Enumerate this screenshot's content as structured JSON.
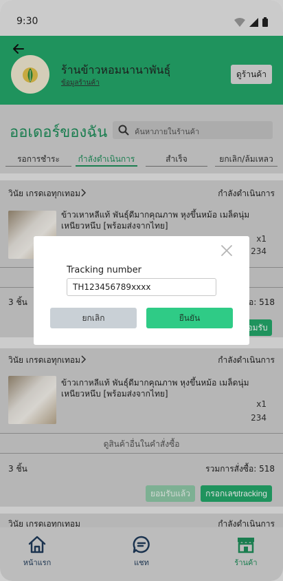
{
  "status_bar": {
    "time": "9:30"
  },
  "header": {
    "shop_name": "ร้านข้าวหอมนานาพันธุ์",
    "shop_info_link": "ข้อมูลร้านค้า",
    "view_shop_button": "ดูร้านค้า"
  },
  "page": {
    "title": "ออเดอร์ของฉัน",
    "search_placeholder": "ค้นหาภายในร้านค้า"
  },
  "tabs": [
    {
      "label": "รอการชำระ"
    },
    {
      "label": "กำลังดำเนินการ"
    },
    {
      "label": "สำเร็จ"
    },
    {
      "label": "ยกเลิก/ล้มเหลว"
    }
  ],
  "orders": [
    {
      "seller": "วินัย เกรดเอทุกเทอม",
      "status": "กำลังดำเนินการ",
      "product_name": "ข้าวเหาหลีแท้ พันธุ์ดีมากคุณภาพ หุงขึ้นหม้อ  เมล็ดนุ่มเหนียวหนึบ [พร้อมส่งจากไทย]",
      "quantity": "x1",
      "price": "234",
      "count": "3 ชิ้น",
      "total_label": "รวมการสั่งซื้อ:",
      "total_partial": "ซื้อ:",
      "total_value": "518",
      "action_partial": "อมรับ"
    },
    {
      "seller": "วินัย เกรดเอทุกเทอม",
      "status": "กำลังดำเนินการ",
      "product_name": "ข้าวเกาหลีแท้ พันธุ์ดีมากคุณภาพ หุงขึ้นหม้อ  เมล็ดนุ่มเหนียวหนึบ [พร้อมส่งจากไทย]",
      "quantity": "x1",
      "price": "234",
      "see_more": "ดูสินค้าอื่นในคำสั่งซื้อ",
      "count": "3 ชิ้น",
      "total_label": "รวมการสั่งซื้อ:",
      "total_value": "518",
      "received_button": "ยอมรับแล้ว",
      "tracking_button": "กรอกเลขtracking"
    },
    {
      "seller": "วินัย เกรดเอทุกเทอม",
      "status": "กำลังดำเนินการ"
    }
  ],
  "modal": {
    "label": "Tracking number",
    "input_value": "TH123456789xxxx",
    "cancel_button": "ยกเลิก",
    "confirm_button": "ยืนยัน"
  },
  "bottom_nav": [
    {
      "label": "หน้าแรก",
      "icon": "home-icon"
    },
    {
      "label": "แชท",
      "icon": "chat-icon"
    },
    {
      "label": "ร้านค้า",
      "icon": "store-icon"
    }
  ],
  "colors": {
    "brand_green": "#24a86a",
    "accent_green": "#1e8f5b",
    "confirm_green": "#2fcb86",
    "nav_blue": "#1f3b5a"
  }
}
